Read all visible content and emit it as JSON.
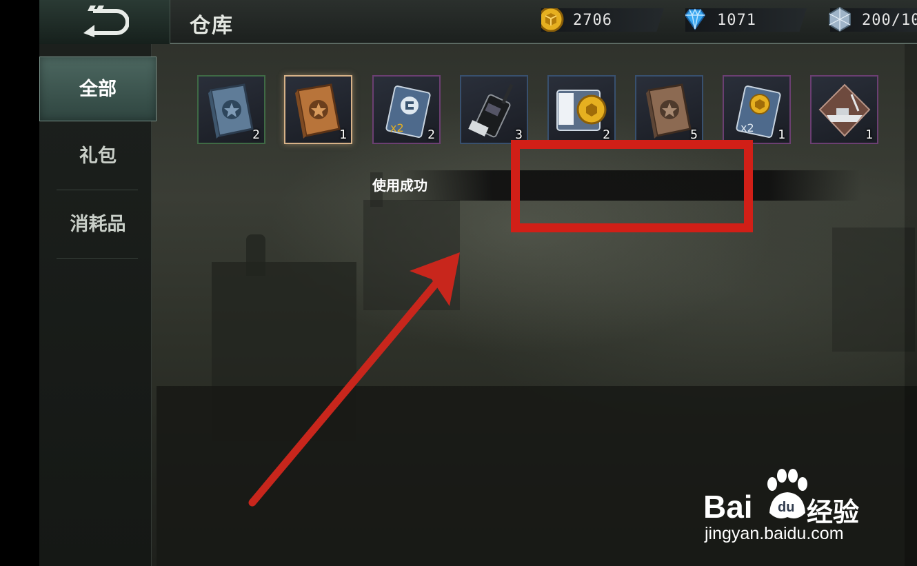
{
  "header": {
    "title": "仓库",
    "currencies": [
      {
        "name": "gold",
        "value": "2706",
        "icon": "gold-coin-icon",
        "color": "#e6b020"
      },
      {
        "name": "diamond",
        "value": "1071",
        "icon": "diamond-icon",
        "color": "#3aa7f0"
      },
      {
        "name": "stamina",
        "value": "200/10",
        "icon": "crystal-icon",
        "color": "#9fb4c8"
      }
    ]
  },
  "sidebar": {
    "tabs": [
      {
        "label": "全部",
        "active": true
      },
      {
        "label": "礼包",
        "active": false
      },
      {
        "label": "消耗品",
        "active": false
      }
    ]
  },
  "items": [
    {
      "icon": "blue-star-book-icon",
      "count": "2",
      "rarity": "green"
    },
    {
      "icon": "bronze-star-book-icon",
      "count": "1",
      "rarity": "orange"
    },
    {
      "icon": "double-exp-card-icon",
      "count": "2",
      "rarity": "purple"
    },
    {
      "icon": "walkie-talkie-icon",
      "count": "3",
      "rarity": "blue"
    },
    {
      "icon": "contract-coin-card-icon",
      "count": "2",
      "rarity": "blue"
    },
    {
      "icon": "brown-star-book-icon",
      "count": "5",
      "rarity": "blue"
    },
    {
      "icon": "double-gold-card-icon",
      "count": "1",
      "rarity": "purple"
    },
    {
      "icon": "warship-emblem-icon",
      "count": "1",
      "rarity": "purple"
    }
  ],
  "toast": {
    "message": "使用成功"
  },
  "annotation": {
    "highlight_color": "#d11f17",
    "arrow_color": "#c8261c"
  },
  "watermark": {
    "brand_left": "Bai",
    "brand_right": "经验",
    "url": "jingyan.baidu.com",
    "paw_text": "du"
  }
}
